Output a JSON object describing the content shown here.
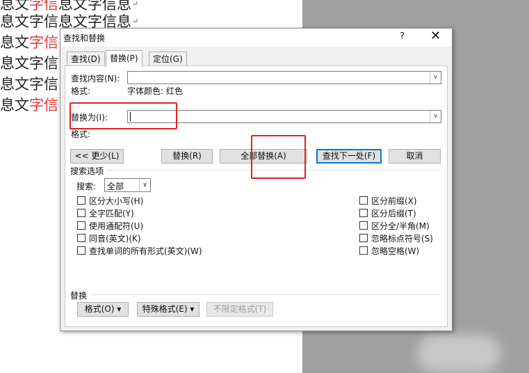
{
  "document": {
    "lines": [
      {
        "before": "息文",
        "red": "字信",
        "after": "息文字信息",
        "mark": "↵"
      },
      {
        "before": "息文字信息文字信息",
        "red": "",
        "after": "",
        "mark": "↵"
      },
      {
        "before": "息文",
        "red": "字信",
        "after": "",
        "mark": ""
      },
      {
        "before": "息文字信",
        "red": "",
        "after": "",
        "mark": ""
      },
      {
        "before": "息文字信",
        "red": "",
        "after": "",
        "mark": ""
      },
      {
        "before": "息文",
        "red": "字信",
        "after": "",
        "mark": ""
      }
    ]
  },
  "dialog": {
    "title": "查找和替换",
    "help": "?",
    "close": "✕",
    "tabs": [
      "查找(D)",
      "替换(P)",
      "定位(G)"
    ],
    "find_label": "查找内容(N):",
    "find_value": "",
    "find_format_label": "格式:",
    "find_format_value": "字体颜色: 红色",
    "replace_label": "替换为(I):",
    "replace_value": "",
    "replace_format_label": "格式:",
    "buttons": {
      "less": "<< 更少(L)",
      "replace": "替换(R)",
      "replace_all": "全部替换(A)",
      "find_next": "查找下一处(F)",
      "cancel": "取消"
    },
    "search_options_title": "搜索选项",
    "search_label": "搜索:",
    "search_value": "全部",
    "options_left": [
      "区分大小写(H)",
      "全字匹配(Y)",
      "使用通配符(U)",
      "同音(英文)(K)",
      "查找单词的所有形式(英文)(W)"
    ],
    "options_right": [
      "区分前缀(X)",
      "区分后缀(T)",
      "区分全/半角(M)",
      "忽略标点符号(S)",
      "忽略空格(W)"
    ],
    "replace_section_title": "替换",
    "bottom_buttons": {
      "format": "格式(O) ▾",
      "special": "特殊格式(E) ▾",
      "no_format": "不限定格式(T)"
    },
    "arrow": "∨"
  }
}
